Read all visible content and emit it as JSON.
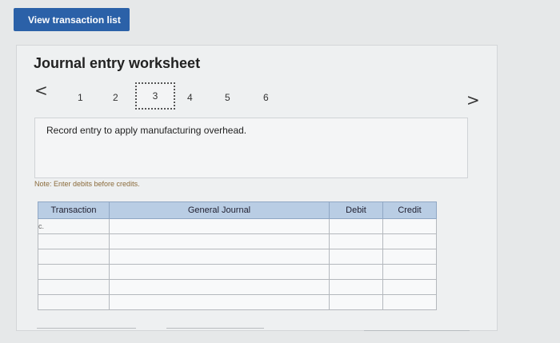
{
  "header": {
    "view_button_label": "View transaction list"
  },
  "worksheet": {
    "title": "Journal entry worksheet",
    "prev_glyph": "<",
    "next_glyph": ">",
    "steps": [
      "1",
      "2",
      "3",
      "4",
      "5",
      "6"
    ],
    "active_step": "3",
    "instruction": "Record entry to apply manufacturing overhead.",
    "note": "Note: Enter debits before credits."
  },
  "table": {
    "headers": {
      "transaction": "Transaction",
      "general_journal": "General Journal",
      "debit": "Debit",
      "credit": "Credit"
    },
    "rows": [
      {
        "transaction": "c.",
        "account": "",
        "debit": "",
        "credit": ""
      },
      {
        "transaction": "",
        "account": "",
        "debit": "",
        "credit": ""
      },
      {
        "transaction": "",
        "account": "",
        "debit": "",
        "credit": ""
      },
      {
        "transaction": "",
        "account": "",
        "debit": "",
        "credit": ""
      },
      {
        "transaction": "",
        "account": "",
        "debit": "",
        "credit": ""
      },
      {
        "transaction": "",
        "account": "",
        "debit": "",
        "credit": ""
      }
    ]
  },
  "colors": {
    "button_blue": "#2b61a8",
    "header_blue": "#b9cde4",
    "input_border": "#2f4f72"
  }
}
